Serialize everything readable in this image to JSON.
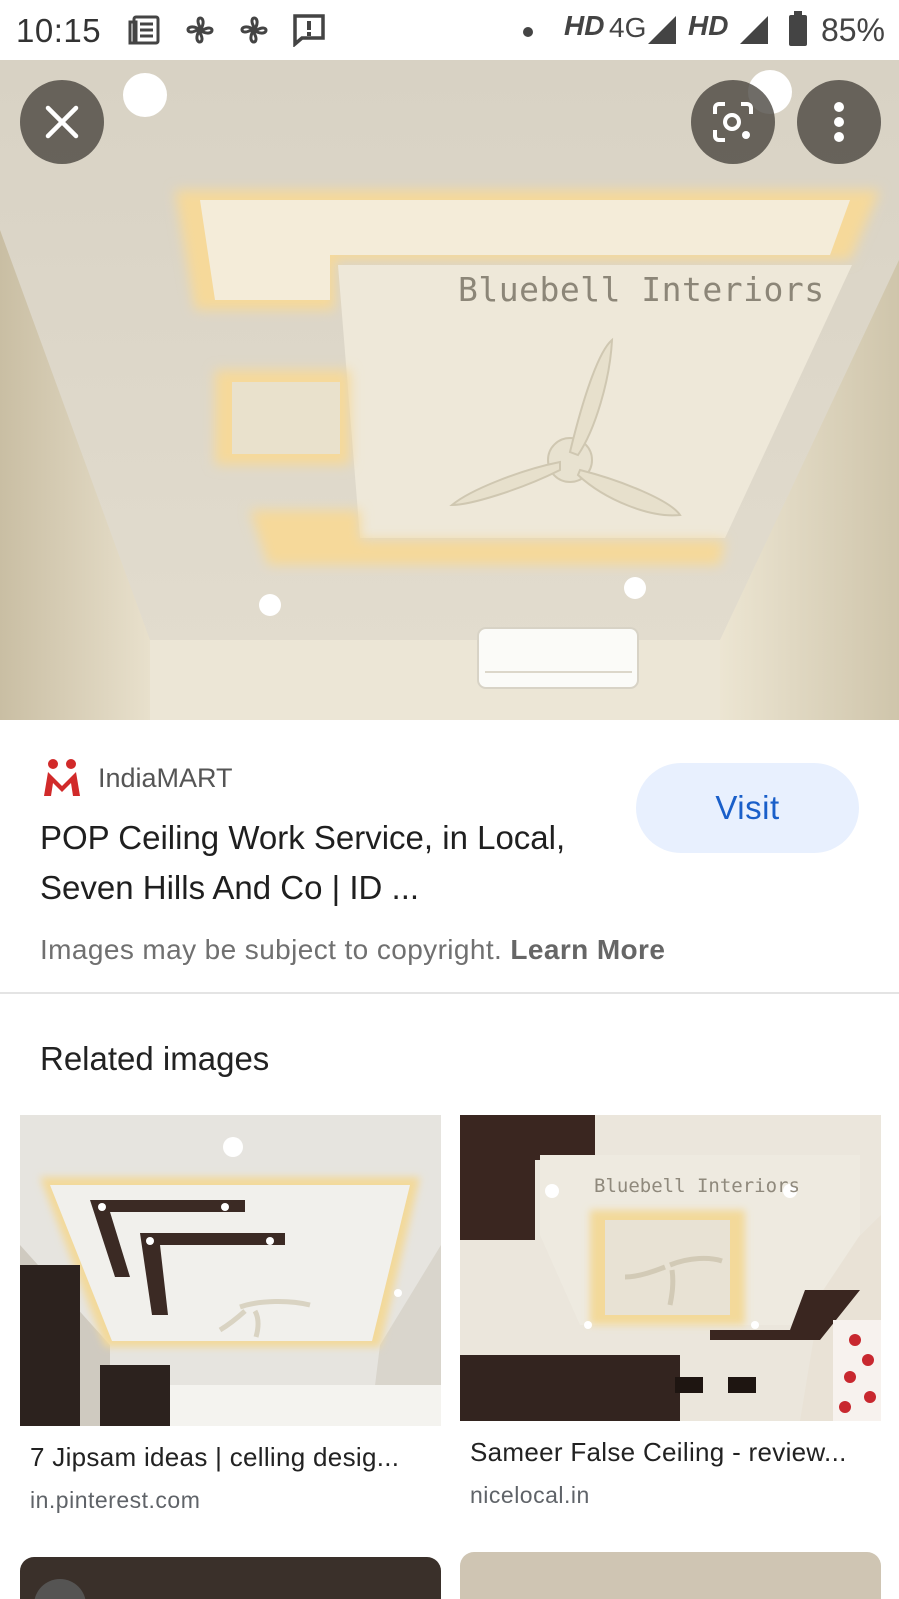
{
  "status_bar": {
    "time": "10:15",
    "network_left": "HD",
    "network_type": "4G",
    "network_right": "HD",
    "battery": "85%"
  },
  "hero": {
    "watermark": "Bluebell Interiors",
    "close_icon": "close-icon",
    "lens_icon": "lens-icon",
    "more_icon": "more-vert-icon"
  },
  "result": {
    "source": "IndiaMART",
    "title": "POP Ceiling Work Service, in Local, Seven Hills And Co | ID ...",
    "visit_label": "Visit",
    "copyright_text": "Images may be subject to copyright.",
    "learn_more": "Learn More"
  },
  "related": {
    "heading": "Related images",
    "items": [
      {
        "caption": "7 Jipsam ideas | celling desig...",
        "domain": "in.pinterest.com"
      },
      {
        "caption": "Sameer False Ceiling - review...",
        "domain": "nicelocal.in",
        "watermark": "Bluebell Interiors"
      }
    ]
  },
  "colors": {
    "visit_bg": "#e8f0fe",
    "visit_text": "#1a5fc9",
    "brand_red": "#d12a2a"
  }
}
